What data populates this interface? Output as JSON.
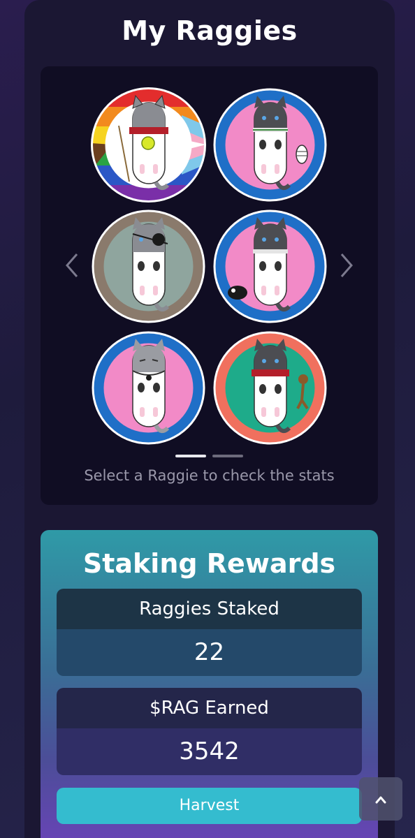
{
  "page": {
    "title": "My Raggies",
    "hint": "Select a Raggie to check the stats"
  },
  "gallery": {
    "prev_icon": "chevron-left-icon",
    "next_icon": "chevron-right-icon",
    "pages": 2,
    "current_page": 1,
    "raggies": [
      {
        "id": 1,
        "ring": "rainbow-pride",
        "inner": "#f6f6f6",
        "accessory": "tennis-ball-and-flag"
      },
      {
        "id": 2,
        "ring": "#1f6fc7",
        "inner": "#f28ac7",
        "accessory": "fish-skeleton"
      },
      {
        "id": 3,
        "ring": "#8a7a6c",
        "inner": "#8fa59e",
        "accessory": "eye-patch"
      },
      {
        "id": 4,
        "ring": "#1f6fc7",
        "inner": "#f28ac7",
        "accessory": "cow"
      },
      {
        "id": 5,
        "ring": "#1f6fc7",
        "inner": "#f28ac7",
        "accessory": "bead-necklace"
      },
      {
        "id": 6,
        "ring": "#f0705e",
        "inner": "#1eab8a",
        "accessory": "monkey"
      }
    ]
  },
  "rewards": {
    "title": "Staking Rewards",
    "staked_label": "Raggies Staked",
    "staked_value": "22",
    "earned_label": "$RAG Earned",
    "earned_value": "3542",
    "harvest_label": "Harvest"
  },
  "scroll_top_icon": "chevron-up-icon"
}
